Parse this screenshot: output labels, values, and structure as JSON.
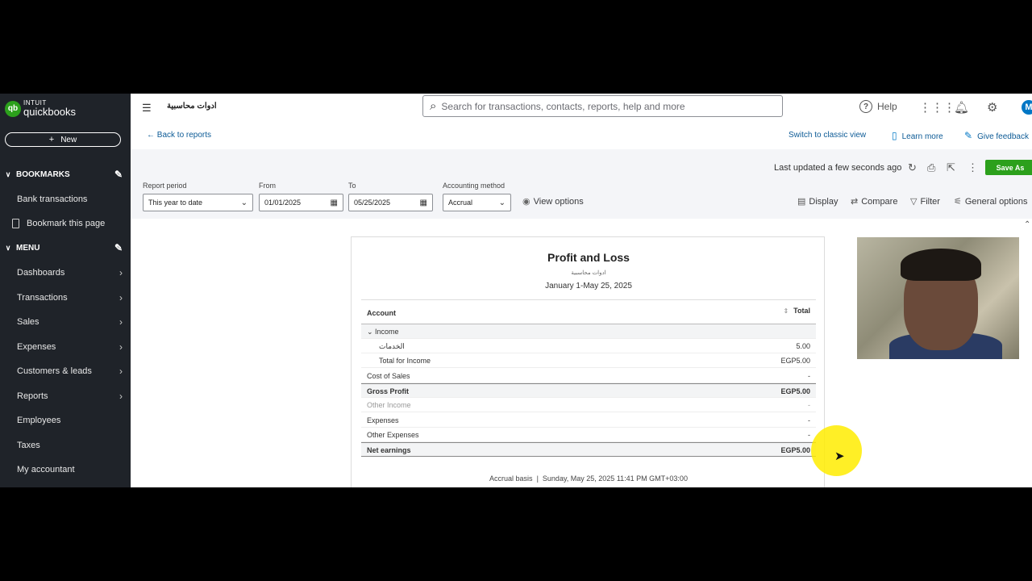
{
  "app": {
    "logo_intuit": "INTUIT",
    "logo_name": "quickbooks",
    "company_name": "ادوات محاسبية"
  },
  "sidebar": {
    "new_label": "New",
    "bookmarks_header": "BOOKMARKS",
    "bookmarks": [
      {
        "label": "Bank transactions"
      },
      {
        "label": "Bookmark this page"
      }
    ],
    "menu_header": "MENU",
    "menu": [
      {
        "label": "Dashboards"
      },
      {
        "label": "Transactions"
      },
      {
        "label": "Sales"
      },
      {
        "label": "Expenses"
      },
      {
        "label": "Customers & leads"
      },
      {
        "label": "Reports"
      },
      {
        "label": "Employees"
      },
      {
        "label": "Taxes"
      },
      {
        "label": "My accountant"
      }
    ]
  },
  "topbar": {
    "search_placeholder": "Search for transactions, contacts, reports, help and more",
    "help_label": "Help",
    "avatar_initial": "M"
  },
  "links": {
    "back": "Back to reports",
    "classic": "Switch to classic view",
    "learn": "Learn more",
    "feedback": "Give feedback"
  },
  "toolbar": {
    "last_updated": "Last updated a few seconds ago",
    "save_as": "Save As",
    "report_period_label": "Report period",
    "report_period_value": "This year to date",
    "from_label": "From",
    "from_value": "01/01/2025",
    "to_label": "To",
    "to_value": "05/25/2025",
    "method_label": "Accounting method",
    "method_value": "Accrual",
    "view_options": "View options",
    "display": "Display",
    "compare": "Compare",
    "filter": "Filter",
    "general_options": "General options"
  },
  "report": {
    "title": "Profit and Loss",
    "company": "ادوات محاسبية",
    "date_range": "January 1-May 25, 2025",
    "col_account": "Account",
    "col_total": "Total",
    "rows": [
      {
        "label": "Income",
        "value": ""
      },
      {
        "label": "الخدمات",
        "value": "5.00"
      },
      {
        "label": "Total for Income",
        "value": "EGP5.00"
      },
      {
        "label": "Cost of Sales",
        "value": "-"
      },
      {
        "label": "Gross Profit",
        "value": "EGP5.00"
      },
      {
        "label": "Other Income",
        "value": "-"
      },
      {
        "label": "Expenses",
        "value": "-"
      },
      {
        "label": "Other Expenses",
        "value": "-"
      },
      {
        "label": "Net earnings",
        "value": "EGP5.00"
      }
    ],
    "footer_basis": "Accrual basis",
    "footer_timestamp": "Sunday, May 25, 2025 11:41 PM GMT+03:00"
  }
}
